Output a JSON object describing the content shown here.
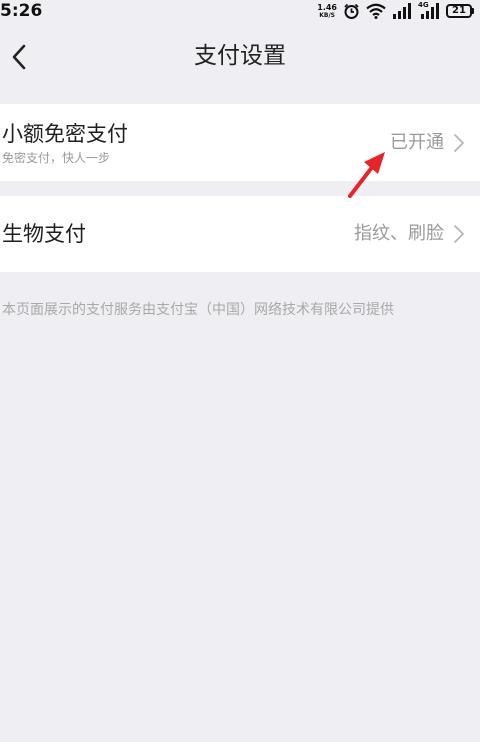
{
  "status_bar": {
    "time": "5:26",
    "net_speed_value": "1.46",
    "net_speed_unit": "KB/S",
    "network_label": "4G",
    "battery_level": "21",
    "icons": [
      "alarm-icon",
      "wifi-icon",
      "signal-icon",
      "signal-4g-icon",
      "battery-icon"
    ]
  },
  "nav": {
    "title": "支付设置",
    "back_icon": "chevron-left-icon"
  },
  "settings": {
    "nopassword": {
      "title": "小额免密支付",
      "subtitle": "免密支付，快人一步",
      "value": "已开通"
    },
    "biometric": {
      "title": "生物支付",
      "value": "指纹、刷脸"
    }
  },
  "footer": {
    "note": "本页面展示的支付服务由支付宝（中国）网络技术有限公司提供"
  },
  "colors": {
    "background": "#efeef3",
    "card": "#ffffff",
    "secondary_text": "#9a9a9a",
    "annotation_arrow": "#e8242b"
  }
}
